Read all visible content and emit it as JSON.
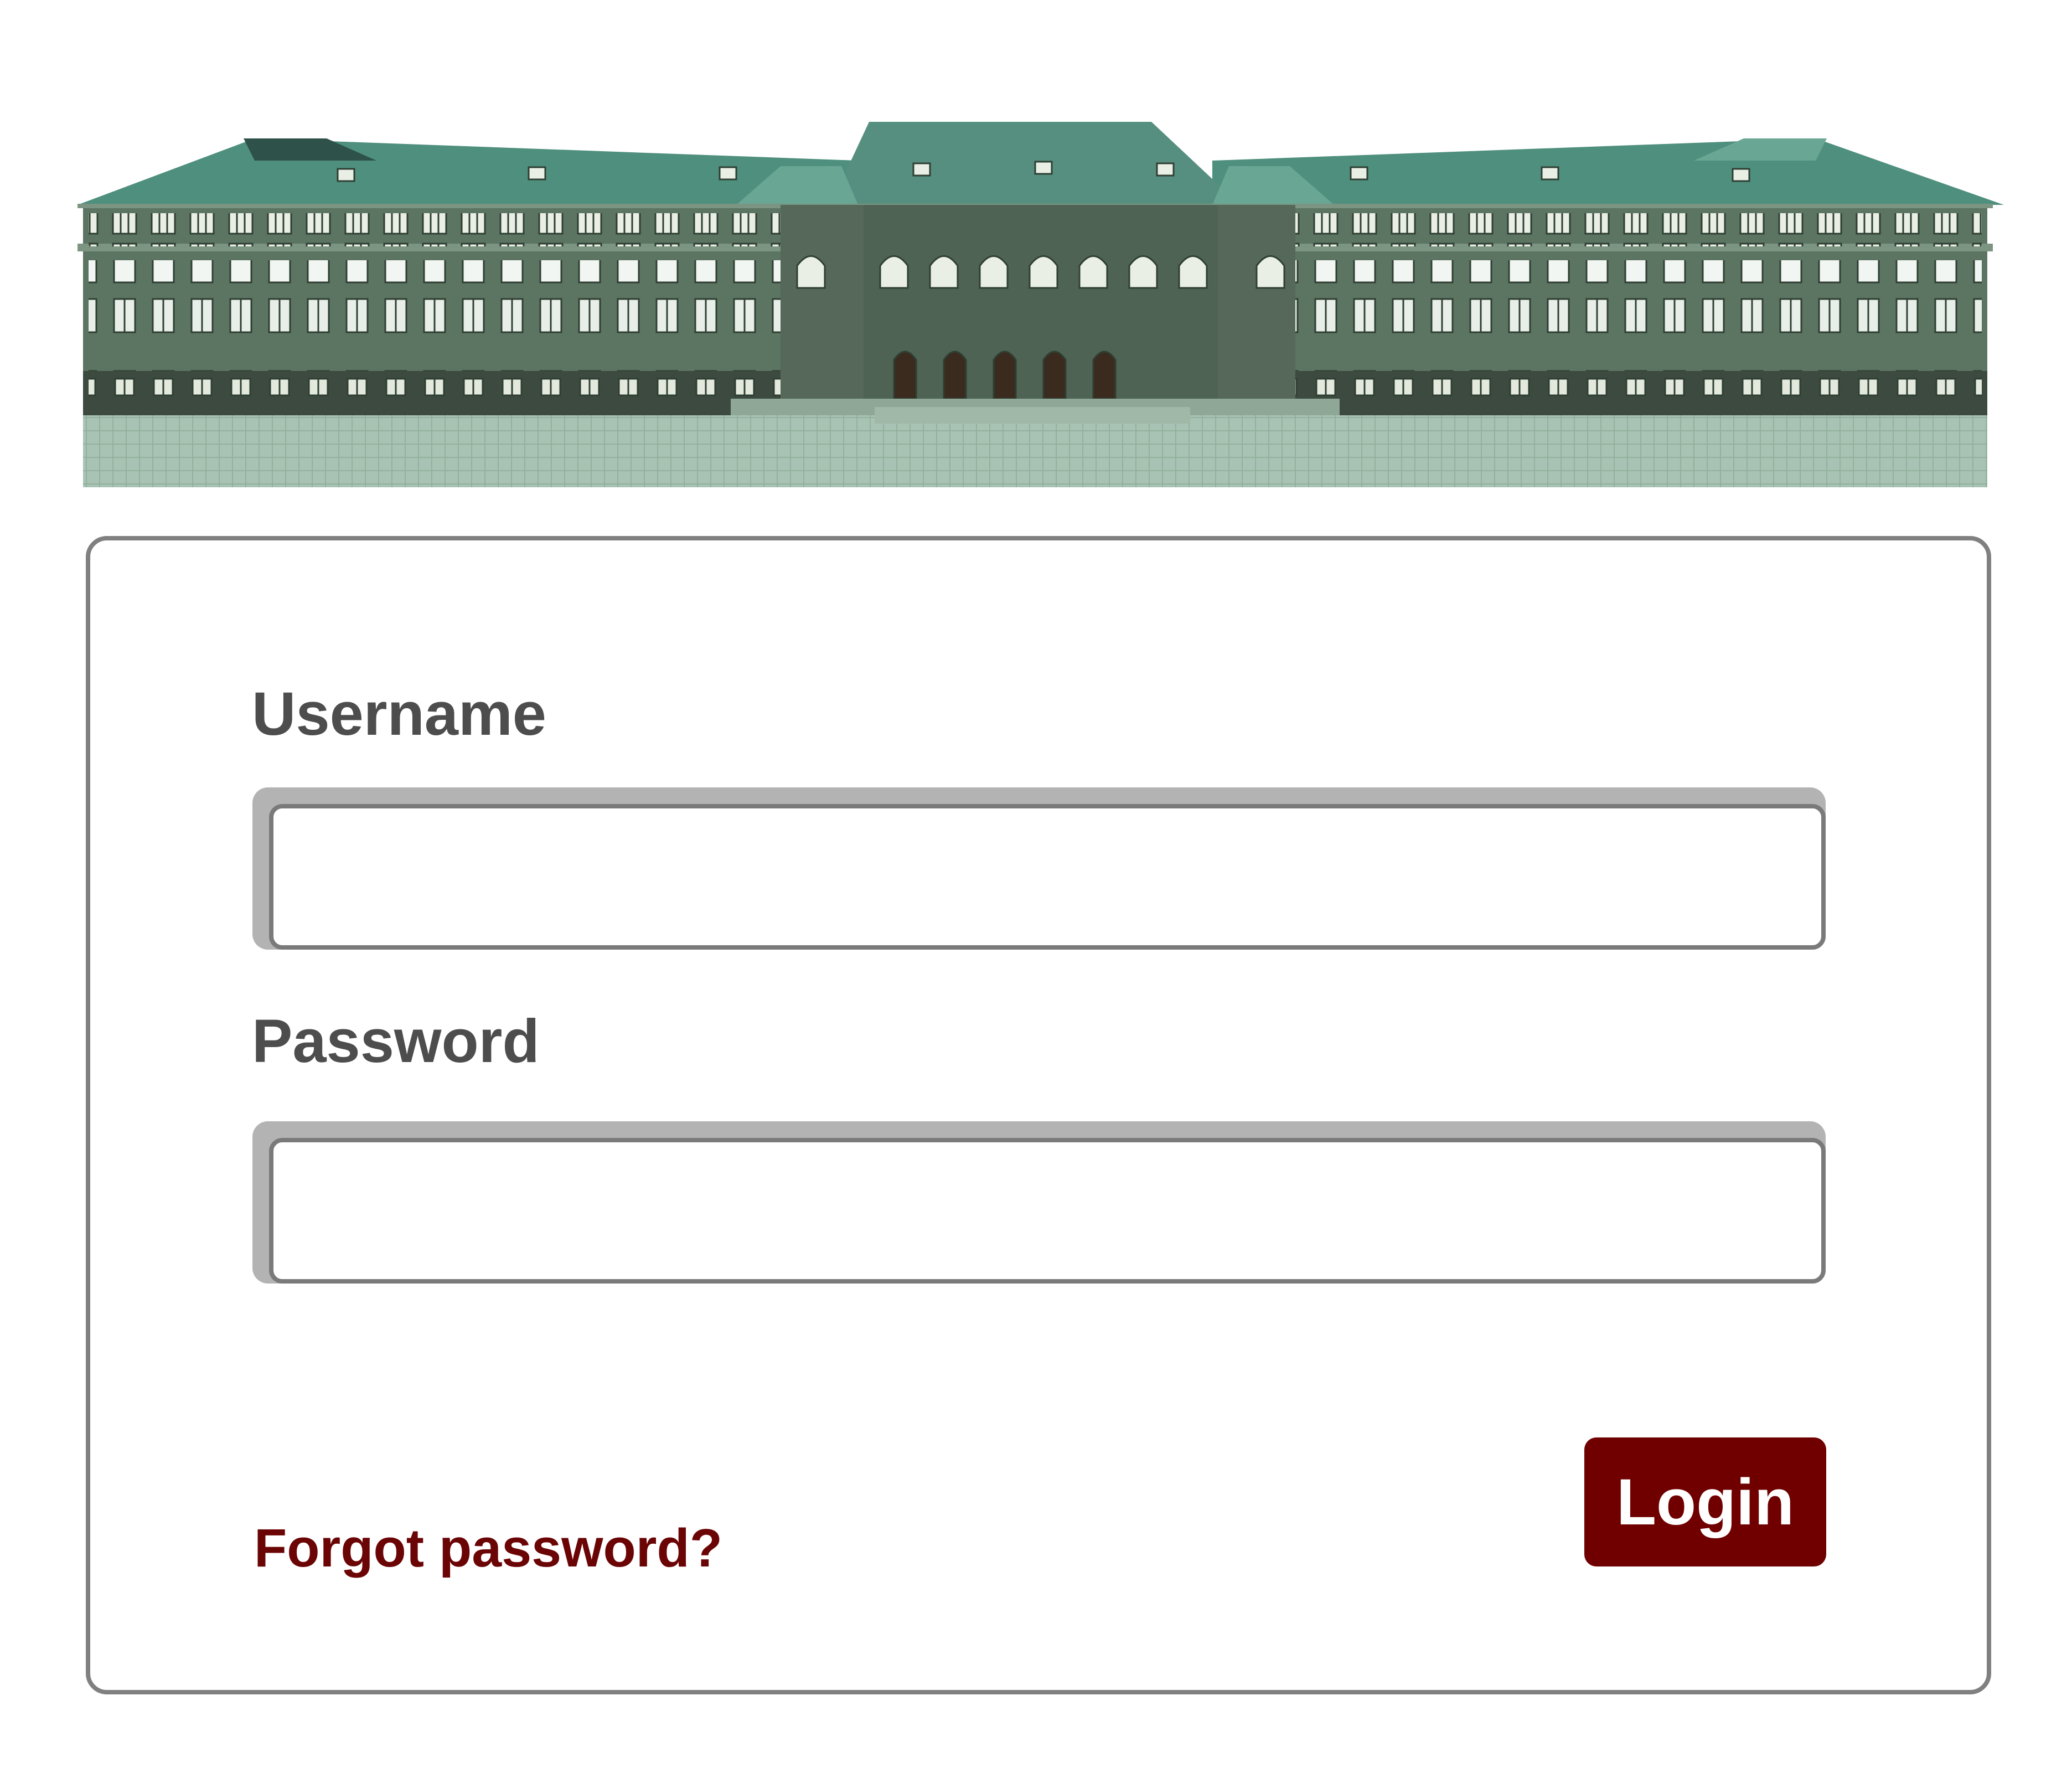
{
  "header": {
    "image": "building-illustration"
  },
  "login_form": {
    "username": {
      "label": "Username",
      "value": "",
      "placeholder": ""
    },
    "password": {
      "label": "Password",
      "value": "",
      "placeholder": ""
    },
    "forgot_password_label": "Forgot password?",
    "login_label": "Login"
  },
  "colors": {
    "accent": "#700000",
    "link": "#6b0404",
    "label_text": "#4d4d4d",
    "card_border": "#808080",
    "input_shadow": "#b3b3b3",
    "roof": "#4f8f7d",
    "facade": "#5c7462"
  }
}
